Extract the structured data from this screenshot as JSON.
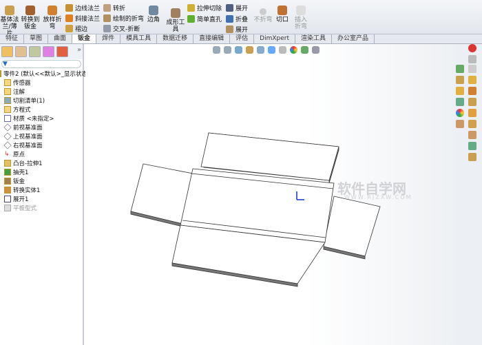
{
  "ribbon": {
    "big": [
      "基体法兰/薄片",
      "转换到钣金",
      "放样折弯",
      "边角",
      "成形工具",
      "切口",
      "插入折弯"
    ],
    "small": [
      "边线法兰",
      "斜接法兰",
      "褶边",
      "转折",
      "绘制的折弯",
      "交叉-折断",
      "拉伸切除",
      "简单直孔",
      "展开",
      "折叠",
      "展开",
      "不折弯"
    ]
  },
  "tabs": [
    "特征",
    "草图",
    "曲面",
    "钣金",
    "焊件",
    "模具工具",
    "数据迁移",
    "直接编辑",
    "评估",
    "DimXpert",
    "渲染工具",
    "办公室产品"
  ],
  "active_tab": "钣金",
  "tree": {
    "root": "零件2 (默认<<默认>_显示状态",
    "items": [
      "传感器",
      "注解",
      "切割清单(1)",
      "方程式",
      "材质 <未指定>",
      "前视基准面",
      "上视基准面",
      "右视基准面",
      "原点",
      "凸台-拉伸1",
      "抽壳1",
      "钣金",
      "转换实体1",
      "展开1",
      "平板型式"
    ]
  },
  "panel_more": "»",
  "watermark": {
    "title": "软件自学网",
    "url": "WWW.RJZXW.COM"
  }
}
